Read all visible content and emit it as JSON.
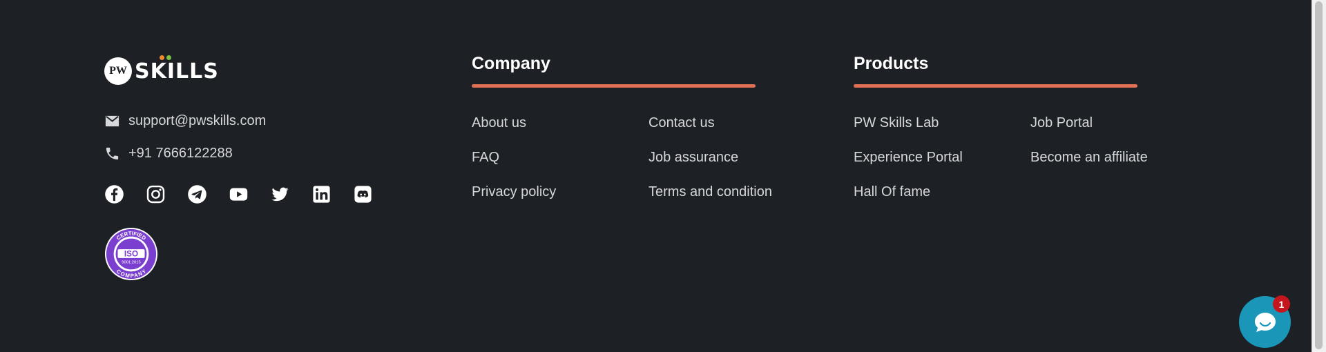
{
  "logo": {
    "mark": "PW",
    "word": "SKILLS"
  },
  "contact": {
    "email": "support@pwskills.com",
    "phone": "+91 7666122288"
  },
  "socials": [
    "facebook-icon",
    "instagram-icon",
    "telegram-icon",
    "youtube-icon",
    "twitter-icon",
    "linkedin-icon",
    "discord-icon"
  ],
  "iso_badge": {
    "top": "CERTIFIED",
    "center": "ISO",
    "code": "9001:2015",
    "bottom": "COMPANY"
  },
  "company": {
    "title": "Company",
    "links": [
      "About us",
      "Contact us",
      "FAQ",
      "Job assurance",
      "Privacy policy",
      "Terms and condition"
    ]
  },
  "products": {
    "title": "Products",
    "links": [
      "PW Skills Lab",
      "Job Portal",
      "Experience Portal",
      "Become an affiliate",
      "Hall Of fame"
    ]
  },
  "chat": {
    "badge": "1"
  },
  "colors": {
    "background": "#1d2024",
    "accent": "#e17055",
    "chat": "#1a97b8",
    "badge": "#c4161c",
    "iso": "#7b3fd0"
  }
}
